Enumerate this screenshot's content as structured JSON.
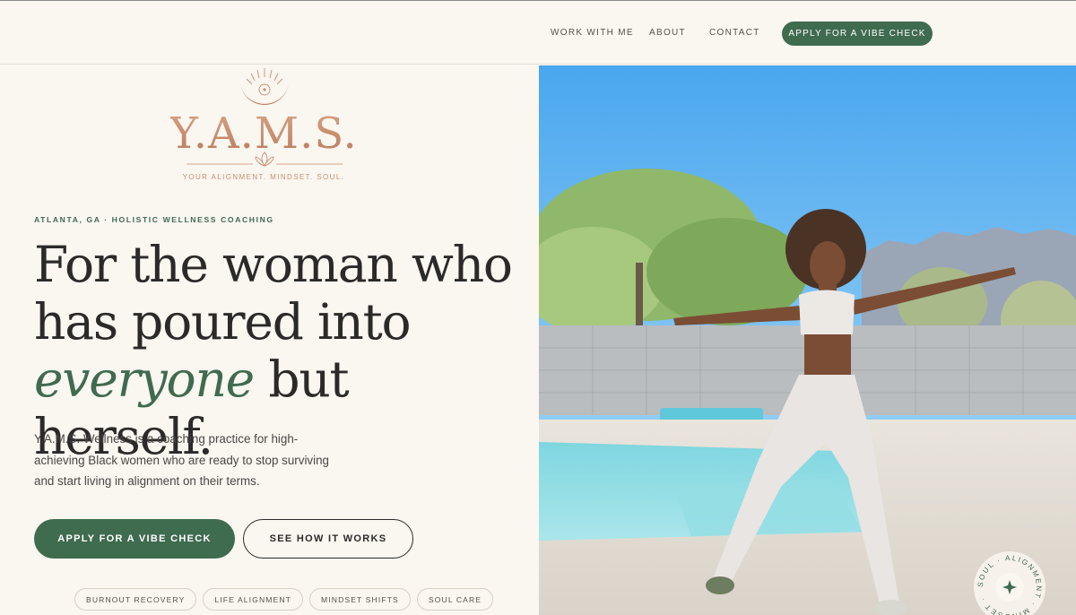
{
  "nav": {
    "links": [
      "WORK WITH ME",
      "ABOUT",
      "CONTACT"
    ],
    "cta": "APPLY FOR A VIBE CHECK"
  },
  "logo": {
    "wordmark": "Y.A.M.S.",
    "tagline": "YOUR ALIGNMENT. MINDSET. SOUL."
  },
  "hero": {
    "eyebrow": "ATLANTA, GA · HOLISTIC WELLNESS COACHING",
    "headline_line1": "For the woman who",
    "headline_line2": "has poured into",
    "headline_accent": "everyone",
    "headline_rest": " but herself.",
    "body": "Y.A.M.S. Wellness is a coaching practice for high-achieving Black women who are ready to stop surviving and start living in alignment on their terms.",
    "primary_button": "APPLY FOR A VIBE CHECK",
    "secondary_button": "SEE HOW IT WORKS",
    "tags": [
      "BURNOUT RECOVERY",
      "LIFE ALIGNMENT",
      "MINDSET SHIFTS",
      "SOUL CARE"
    ]
  },
  "badge": {
    "text": "SOUL · ALIGNMENT · MINDSET ·"
  },
  "colors": {
    "accent_green": "#3f6b4f",
    "logo_copper": "#c98e6e",
    "background": "#faf6f0"
  }
}
